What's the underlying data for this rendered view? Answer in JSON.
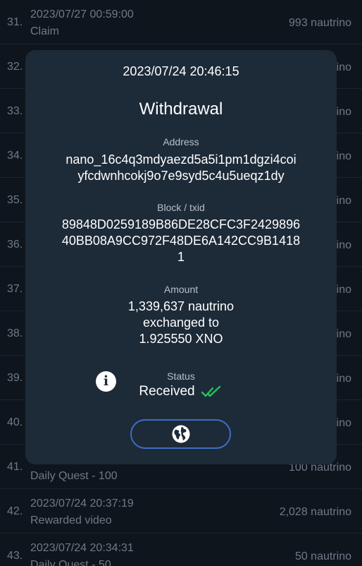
{
  "list": [
    {
      "num": "31.",
      "date": "2023/07/27 00:59:00",
      "desc": "Claim",
      "amount": "993 nautrino"
    },
    {
      "num": "32.",
      "date": "",
      "desc": "",
      "amount": "ino"
    },
    {
      "num": "33.",
      "date": "",
      "desc": "",
      "amount": "ino"
    },
    {
      "num": "34.",
      "date": "",
      "desc": "",
      "amount": "ino"
    },
    {
      "num": "35.",
      "date": "",
      "desc": "",
      "amount": "ino"
    },
    {
      "num": "36.",
      "date": "",
      "desc": "",
      "amount": "ino"
    },
    {
      "num": "37.",
      "date": "",
      "desc": "",
      "amount": "ino"
    },
    {
      "num": "38.",
      "date": "",
      "desc": "",
      "amount": "ino"
    },
    {
      "num": "39.",
      "date": "",
      "desc": "",
      "amount": "ino"
    },
    {
      "num": "40.",
      "date": "",
      "desc": "",
      "amount": "ino"
    },
    {
      "num": "41.",
      "date": "",
      "desc": "Daily Quest - 100",
      "amount": "100 nautrino"
    },
    {
      "num": "42.",
      "date": "2023/07/24 20:37:19",
      "desc": "Rewarded video",
      "amount": "2,028 nautrino"
    },
    {
      "num": "43.",
      "date": "2023/07/24 20:34:31",
      "desc": "Daily Quest - 50",
      "amount": "50 nautrino"
    }
  ],
  "modal": {
    "date": "2023/07/24 20:46:15",
    "title": "Withdrawal",
    "address_label": "Address",
    "address_line1": "nano_16c4q3mdyaezd5a5i1pm1dgzi4coi",
    "address_line2": "yfcdwnhcokj9o7e9syd5c4u5ueqz1dy",
    "block_label": "Block / txid",
    "block_line1": "89848D0259189B86DE28CFC3F2429896",
    "block_line2": "40BB08A9CC972F48DE6A142CC9B1418",
    "block_line3": "1",
    "amount_label": "Amount",
    "amount_line1": "1,339,637 nautrino",
    "amount_line2": "exchanged to",
    "amount_line3": "1.925550 XNO",
    "status_label": "Status",
    "status_value": "Received",
    "info_icon": "i",
    "icons": {
      "info": "info-icon",
      "check": "double-check-icon",
      "explorer": "globe-icon"
    },
    "colors": {
      "check": "#22c35e",
      "button_border": "#3b6fc4",
      "modal_bg": "#1d2a38"
    }
  }
}
